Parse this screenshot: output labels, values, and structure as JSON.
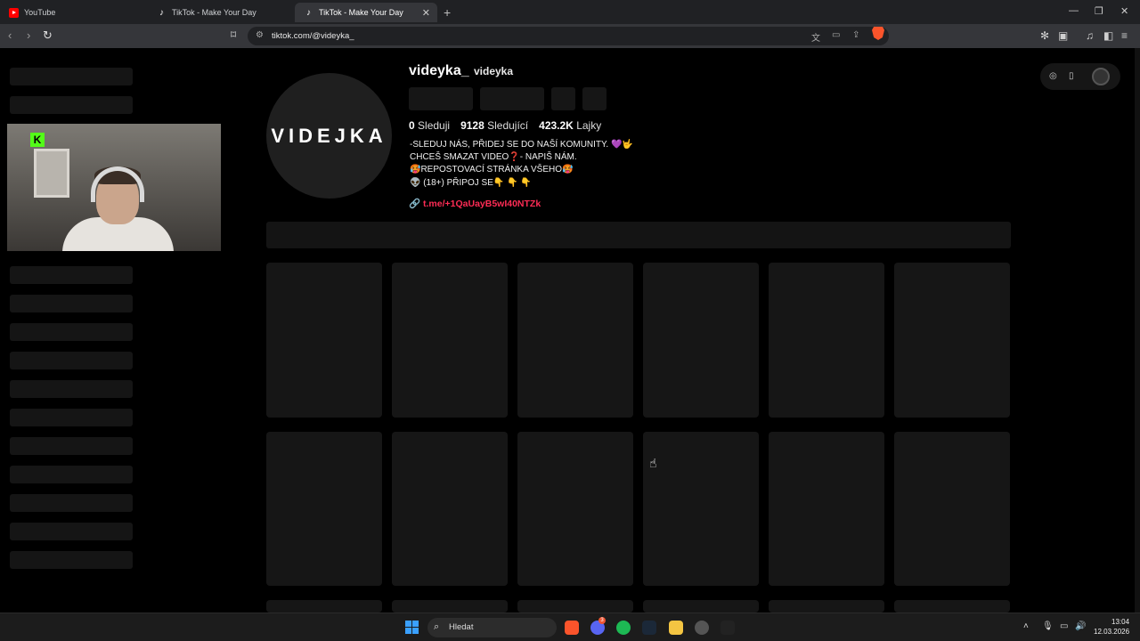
{
  "browser": {
    "tabs": [
      {
        "title": "YouTube",
        "icon": "youtube-icon",
        "active": false
      },
      {
        "title": "TikTok - Make Your Day",
        "icon": "tiktok-icon",
        "active": false
      },
      {
        "title": "TikTok - Make Your Day",
        "icon": "tiktok-icon",
        "active": true
      }
    ],
    "url": "tiktok.com/@videyka_"
  },
  "profile": {
    "avatar_text": "VIDEJKA",
    "username": "videyka_",
    "nickname": "videyka",
    "stats": [
      {
        "value": "0",
        "label": "Sleduji"
      },
      {
        "value": "9128",
        "label": "Sledující"
      },
      {
        "value": "423.2K",
        "label": "Lajky"
      }
    ],
    "bio": [
      "-SLEDUJ NÁS, PŘIDEJ SE DO NAŠÍ KOMUNITY. 💜🤟",
      "CHCEŠ SMAZAT VIDEO❓- NAPIŠ NÁM.",
      "🥵REPOSTOVACÍ STRÁNKA VŠEHO🥵",
      "👽 (18+) PŘIPOJ SE👇 👇 👇"
    ],
    "link": "t.me/+1QaUayB5wI40NTZk"
  },
  "webcam": {
    "badge": "K"
  },
  "taskbar": {
    "search_placeholder": "Hledat",
    "time": "13:04",
    "date": "12.03.2026",
    "discord_badge": "3"
  },
  "colors": {
    "link": "#fe2c55",
    "background": "#000000",
    "skeleton": "#161616"
  }
}
